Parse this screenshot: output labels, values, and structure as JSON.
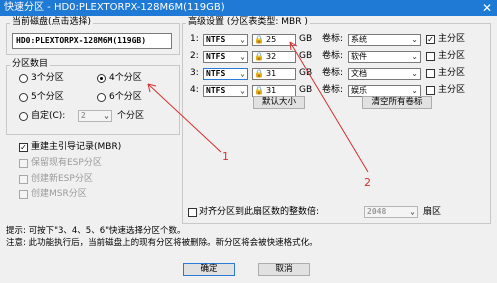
{
  "window": {
    "title": "快速分区 - HD0:PLEXTORPX-128M6M(119GB)",
    "close_glyph": "✕"
  },
  "disk": {
    "group_title": "当前磁盘(点击选择)",
    "value": "HD0:PLEXTORPX-128M6M(119GB)"
  },
  "count_group": {
    "title": "分区数目",
    "options": [
      "3个分区",
      "4个分区",
      "5个分区",
      "6个分区"
    ],
    "selected_index": 1,
    "custom_label": "自定(C):",
    "custom_value": "2",
    "custom_suffix": "个分区"
  },
  "mbr": {
    "rebuild_label": "重建主引导记录(MBR)",
    "rebuild_checked": true,
    "keep_esp": "保留现有ESP分区",
    "create_esp": "创建新ESP分区",
    "create_msr": "创建MSR分区"
  },
  "advanced": {
    "title": "高级设置 (分区表类型: MBR )",
    "size_unit": "GB",
    "vol_label_caption": "卷标:",
    "primary_caption": "主分区",
    "lock_glyph": "🔒",
    "rows": [
      {
        "index": "1:",
        "fs": "NTFS",
        "size": "25",
        "label": "系统",
        "primary": true,
        "selected": false
      },
      {
        "index": "2:",
        "fs": "NTFS",
        "size": "32",
        "label": "软件",
        "primary": false,
        "selected": false
      },
      {
        "index": "3:",
        "fs": "NTFS",
        "size": "31",
        "label": "文档",
        "primary": false,
        "selected": true
      },
      {
        "index": "4:",
        "fs": "NTFS",
        "size": "31",
        "label": "娱乐",
        "primary": false,
        "selected": false
      }
    ],
    "default_size_button": "默认大小",
    "clear_labels_button": "清空所有卷标"
  },
  "align": {
    "label": "对齐分区到此扇区数的整数倍:",
    "value": "2048",
    "suffix": "扇区",
    "checked": false
  },
  "tips": {
    "line1": "提示: 可按下\"3、4、5、6\"快速选择分区个数。",
    "line2": "注意: 此功能执行后，当前磁盘上的现有分区将被删除。新分区将会被快速格式化。"
  },
  "buttons": {
    "ok": "确定",
    "cancel": "取消"
  },
  "annotations": {
    "label_1": "1",
    "label_2": "2",
    "color": "#d93030"
  },
  "colors": {
    "titlebar": "#1f7ad6",
    "accent": "#2a7ad6"
  }
}
